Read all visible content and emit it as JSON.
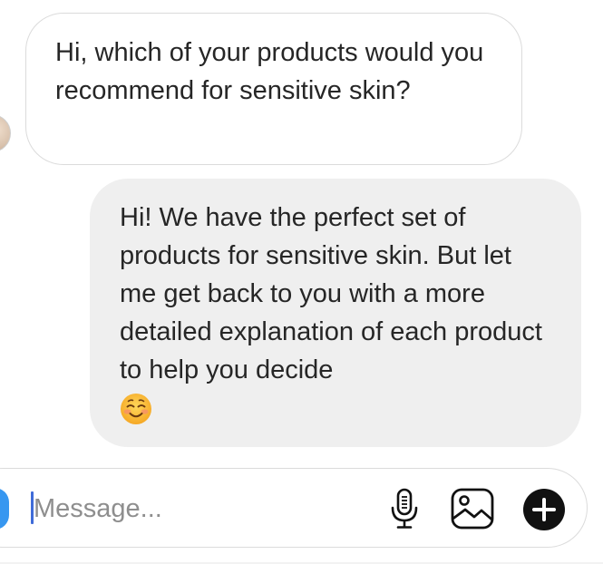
{
  "conversation": {
    "received_message": "Hi, which of your products would you recommend for sensitive skin?",
    "sent_message": "Hi! We have the perfect set of products for sensitive skin. But let me get back to you with a more detailed explanation of each product to help you decide",
    "sent_emoji_icon": "smiling-face-icon"
  },
  "composer": {
    "placeholder": "Message...",
    "value": "",
    "camera_icon": "camera-icon",
    "mic_icon": "microphone-icon",
    "gallery_icon": "image-gallery-icon",
    "add_icon": "plus-circle-icon"
  },
  "colors": {
    "accent": "#3797f0",
    "text": "#262626",
    "placeholder": "#8e8e8e",
    "sent_bubble": "#efefef",
    "border": "#dbdbdb"
  }
}
